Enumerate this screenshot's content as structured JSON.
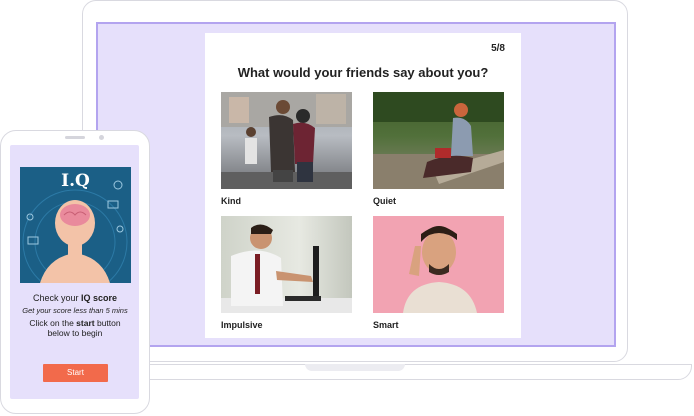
{
  "quiz": {
    "progress": "5/8",
    "question": "What would your friends say about you?",
    "options": [
      {
        "label": "Kind"
      },
      {
        "label": "Quiet"
      },
      {
        "label": "Impulsive"
      },
      {
        "label": "Smart"
      }
    ]
  },
  "phone": {
    "banner_title": "I.Q",
    "line1_prefix": "Check your ",
    "line1_bold": "IQ score",
    "line2": "Get your score less than 5 mins",
    "line3_prefix": "Click on the ",
    "line3_bold": "start",
    "line3_suffix": " button",
    "line4": "below to begin",
    "start_label": "Start"
  },
  "colors": {
    "screen_bg": "#e6e0fb",
    "screen_border": "#b3a4ef",
    "start_button": "#f26a4b",
    "banner": "#1b5f86"
  }
}
